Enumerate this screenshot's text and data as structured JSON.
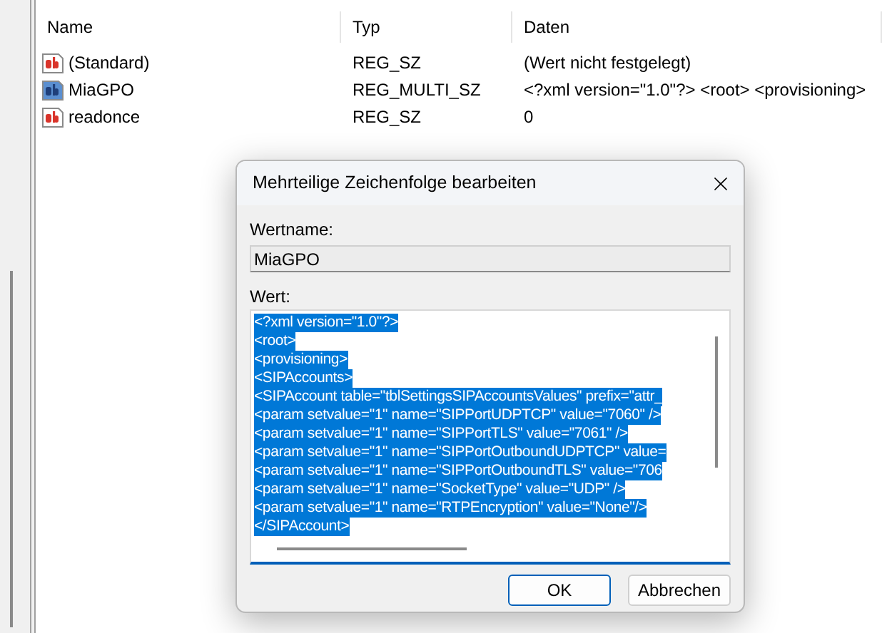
{
  "list": {
    "columns": [
      "Name",
      "Typ",
      "Daten"
    ],
    "rows": [
      {
        "kind": "string",
        "name": "(Standard)",
        "type": "REG_SZ",
        "data": "(Wert nicht festgelegt)"
      },
      {
        "kind": "multi_string",
        "name": "MiaGPO",
        "type": "REG_MULTI_SZ",
        "data": "<?xml version=\"1.0\"?> <root> <provisioning>"
      },
      {
        "kind": "string",
        "name": "readonce",
        "type": "REG_SZ",
        "data": "0"
      }
    ]
  },
  "dialog": {
    "title": "Mehrteilige Zeichenfolge bearbeiten",
    "name_label": "Wertname:",
    "name_value": "MiaGPO",
    "value_label": "Wert:",
    "value_lines": [
      "<?xml version=\"1.0\"?>",
      "<root>",
      "<provisioning>",
      "<SIPAccounts>",
      "<SIPAccount table=\"tblSettingsSIPAccountsValues\" prefix=\"attr_",
      "<param setvalue=\"1\" name=\"SIPPortUDPTCP\" value=\"7060\" />",
      "<param setvalue=\"1\" name=\"SIPPortTLS\" value=\"7061\" />",
      "<param setvalue=\"1\" name=\"SIPPortOutboundUDPTCP\" value=",
      "<param setvalue=\"1\" name=\"SIPPortOutboundTLS\" value=\"706",
      "<param setvalue=\"1\" name=\"SocketType\" value=\"UDP\" />",
      "<param setvalue=\"1\" name=\"RTPEncryption\" value=\"None\"/>",
      "</SIPAccount>"
    ],
    "selected": true,
    "buttons": [
      {
        "label": "OK",
        "selected": true
      },
      {
        "label": "Abbrechen",
        "selected": false
      }
    ]
  }
}
